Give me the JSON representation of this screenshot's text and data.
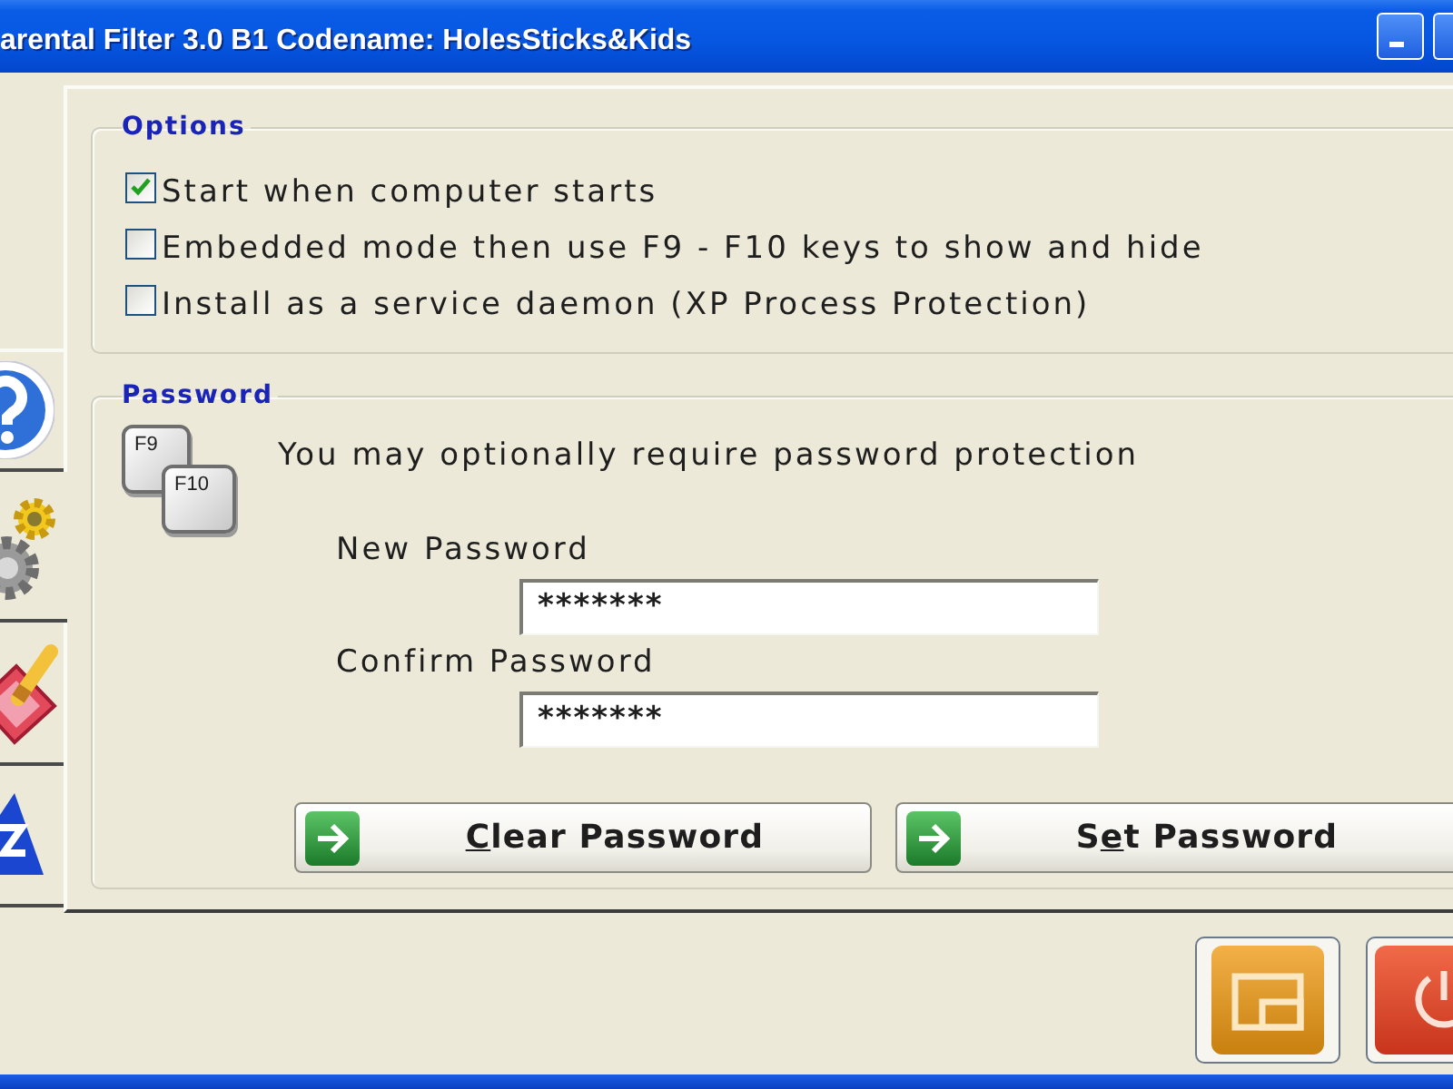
{
  "window": {
    "title": "arental Filter 3.0 B1 Codename: HolesSticks&Kids"
  },
  "tabs": [
    {
      "selected": false
    },
    {
      "selected": true
    },
    {
      "selected": false
    },
    {
      "selected": false
    }
  ],
  "options": {
    "title": "Options",
    "items": [
      {
        "label": "Start when computer starts",
        "checked": true
      },
      {
        "label": "Embedded mode then use F9 - F10 keys to show and hide",
        "checked": false
      },
      {
        "label": "Install as a service daemon (XP Process Protection)",
        "checked": false
      }
    ]
  },
  "password": {
    "title": "Password",
    "keys": [
      "F9",
      "F10"
    ],
    "note": "You may optionally require password protection",
    "fields": [
      {
        "label": "New Password",
        "value": "*******"
      },
      {
        "label": "Confirm Password",
        "value": "*******"
      }
    ],
    "buttons": [
      {
        "access_key": "C",
        "label_end": "lear Password"
      },
      {
        "label_start": "S",
        "access_key": "e",
        "label_end": "t Password"
      }
    ]
  }
}
